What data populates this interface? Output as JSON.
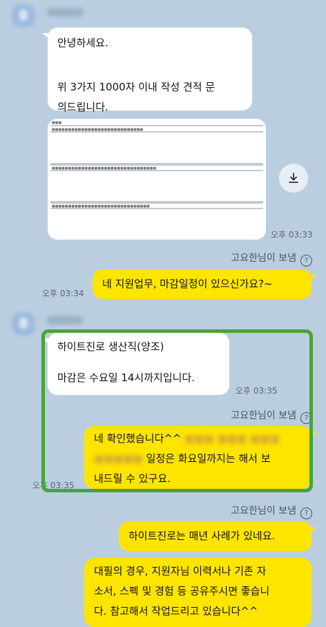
{
  "messages": {
    "m1_lines": [
      "안녕하세요.",
      "",
      "위 3가지 1000자 이내 작성 견적 문",
      "의드립니다."
    ],
    "m1_time": "오후 03:33",
    "sender_note_1": "고요한님이 보냄",
    "m2_text": "네 지원업무, 마감일정이 있으신가요?~",
    "m2_time": "오후 03:34",
    "m3_line1": "하이트진로 생산직(양조)",
    "m3_line2": "마감은 수요일 14시까지입니다.",
    "m3_time": "오후 03:35",
    "sender_note_2": "고요한님이 보냄",
    "m4_line1_visible": "네 확인했습니다^^",
    "m4_line2_tail": " 일정은 화요일까지는 해서 보",
    "m4_line3": "내드릴 수 있구요.",
    "m4_time": "오후 03:35",
    "sender_note_3": "고요한님이 보냄",
    "m5_text": "하이트진로는 매년 사례가 있네요.",
    "m6_lines": [
      "대필의 경우, 지원자님 이력서나 기존 자",
      "소서, 스펙 및 경험 등 공유주시면 좋습니",
      "다. 참고해서 작업드리고 있습니다^^"
    ]
  },
  "icons": {
    "help": "?",
    "download": "download-icon"
  },
  "colors": {
    "background": "#bacee0",
    "my_bubble": "#fee500",
    "their_bubble": "#ffffff",
    "highlight_box": "#48a43a"
  }
}
